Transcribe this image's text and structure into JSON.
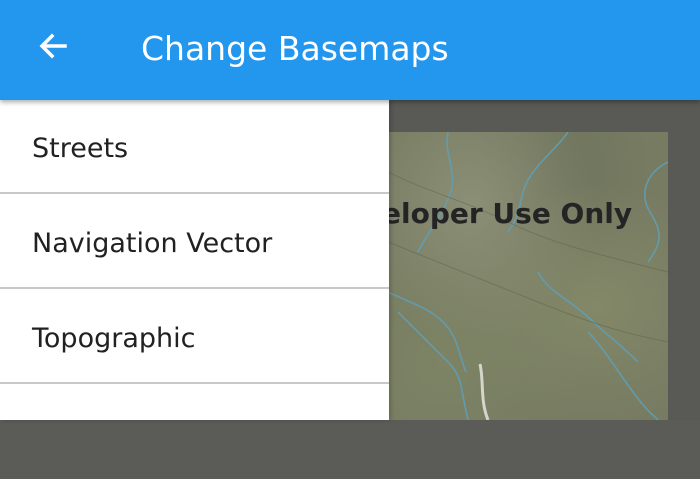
{
  "app_bar": {
    "title": "Change Basemaps",
    "background_color": "#2396ee",
    "back_icon": "arrow-left-icon"
  },
  "basemap_list": {
    "items": [
      {
        "label": "Streets"
      },
      {
        "label": "Navigation Vector"
      },
      {
        "label": "Topographic"
      },
      {
        "label": ""
      }
    ]
  },
  "map": {
    "watermark_text": "eloper Use Only"
  }
}
